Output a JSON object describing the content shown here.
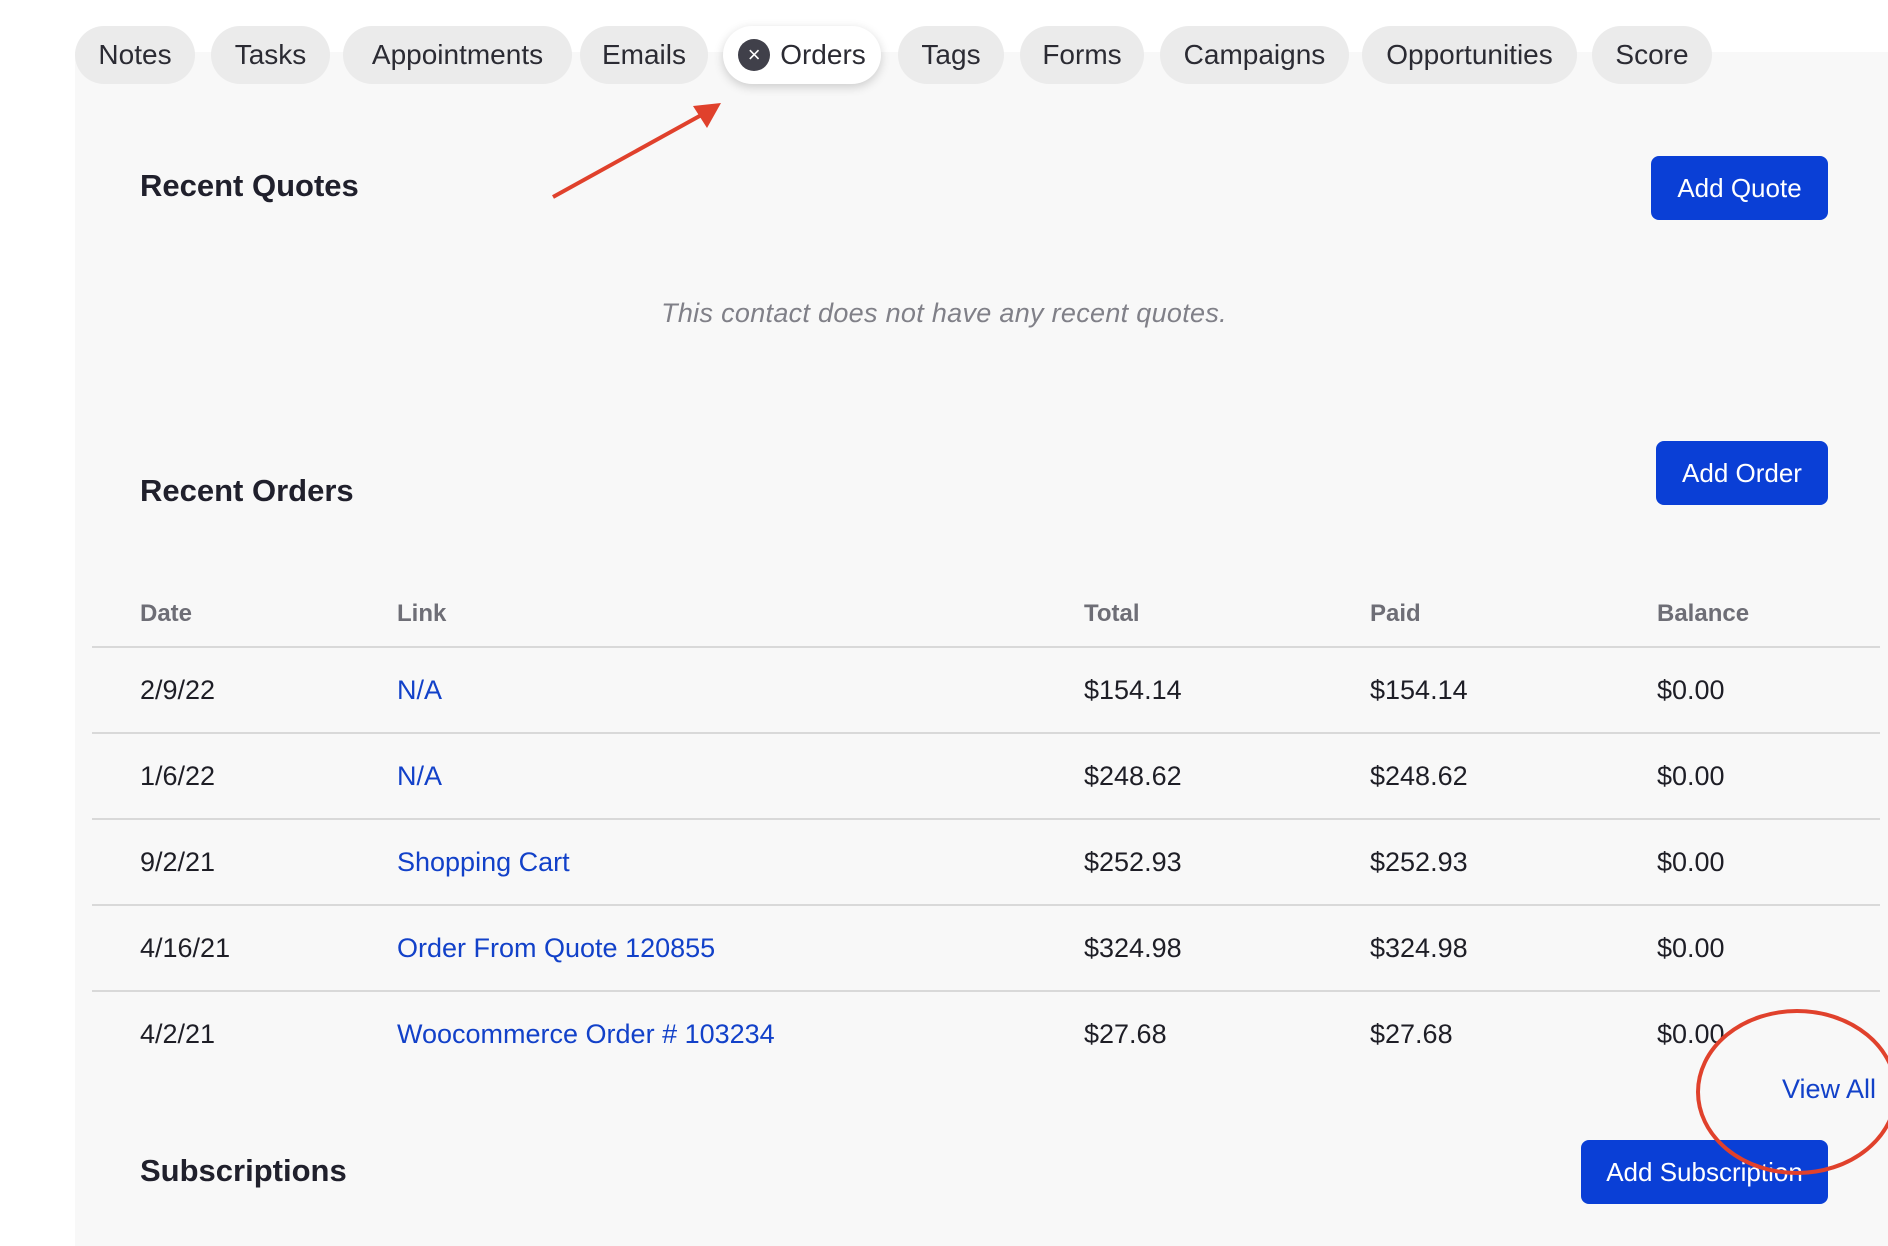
{
  "tabs": [
    {
      "label": "Notes"
    },
    {
      "label": "Tasks"
    },
    {
      "label": "Appointments"
    },
    {
      "label": "Emails"
    },
    {
      "label": "Orders",
      "active": true
    },
    {
      "label": "Tags"
    },
    {
      "label": "Forms"
    },
    {
      "label": "Campaigns"
    },
    {
      "label": "Opportunities"
    },
    {
      "label": "Score"
    }
  ],
  "quotes": {
    "title": "Recent Quotes",
    "add_label": "Add Quote",
    "empty_text": "This contact does not have any recent quotes."
  },
  "orders": {
    "title": "Recent Orders",
    "add_label": "Add Order",
    "columns": [
      "Date",
      "Link",
      "Total",
      "Paid",
      "Balance"
    ],
    "rows": [
      {
        "date": "2/9/22",
        "link": "N/A",
        "total": "$154.14",
        "paid": "$154.14",
        "balance": "$0.00"
      },
      {
        "date": "1/6/22",
        "link": "N/A",
        "total": "$248.62",
        "paid": "$248.62",
        "balance": "$0.00"
      },
      {
        "date": "9/2/21",
        "link": "Shopping Cart",
        "total": "$252.93",
        "paid": "$252.93",
        "balance": "$0.00"
      },
      {
        "date": "4/16/21",
        "link": "Order From Quote 120855",
        "total": "$324.98",
        "paid": "$324.98",
        "balance": "$0.00"
      },
      {
        "date": "4/2/21",
        "link": "Woocommerce Order # 103234",
        "total": "$27.68",
        "paid": "$27.68",
        "balance": "$0.00"
      }
    ],
    "view_all_label": "View All"
  },
  "subscriptions": {
    "title": "Subscriptions",
    "add_label": "Add Subscription"
  },
  "colors": {
    "accent": "#0a3fd6",
    "link": "#1241c9",
    "annotation": "#e0412c"
  }
}
